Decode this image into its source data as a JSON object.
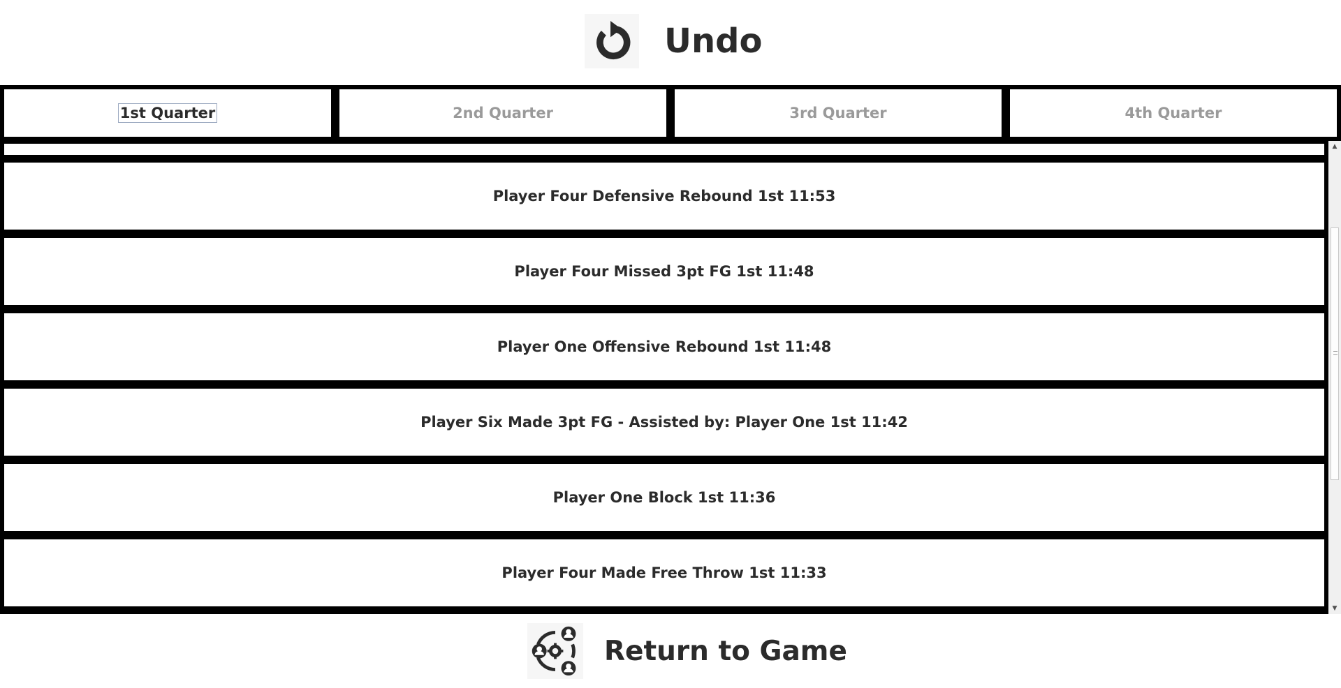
{
  "header": {
    "undo_label": "Undo",
    "undo_icon": "undo-icon"
  },
  "tabs": [
    {
      "label": "1st Quarter",
      "active": true
    },
    {
      "label": "2nd Quarter",
      "active": false
    },
    {
      "label": "3rd Quarter",
      "active": false
    },
    {
      "label": "4th Quarter",
      "active": false
    }
  ],
  "plays": [
    "Player Four Defensive Rebound 1st 11:53",
    "Player Four Missed 3pt FG 1st 11:48",
    "Player One Offensive Rebound 1st 11:48",
    "Player Six Made 3pt FG - Assisted by: Player One 1st 11:42",
    "Player One Block 1st 11:36",
    "Player Four Made Free Throw 1st 11:33"
  ],
  "footer": {
    "return_label": "Return to Game",
    "return_icon": "team-settings-icon"
  },
  "colors": {
    "text": "#2b2b2b",
    "inactive_tab": "#9a9a9a",
    "border": "#000000"
  }
}
